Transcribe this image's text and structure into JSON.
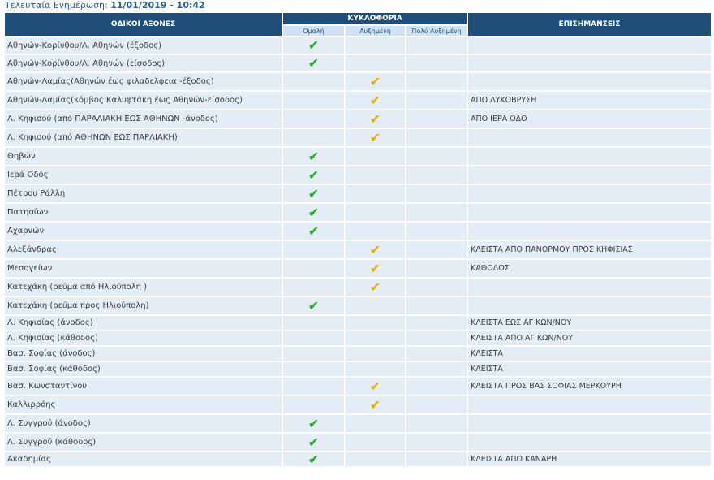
{
  "update": {
    "label": "Τελευταία Ενημέρωση:",
    "value": "11/01/2019 - 10:42"
  },
  "headers": {
    "roads": "ΟΔΙΚΟΙ ΑΞΟΝΕΣ",
    "traffic": "ΚΥΚΛΟΦΟΡΙΑ",
    "notes": "ΕΠΙΣΗΜΑΝΣΕΙΣ",
    "normal": "Ομαλή",
    "increased": "Αυξημένη",
    "very_increased": "Πολύ Αυξημένη"
  },
  "icons": {
    "check": "check-icon",
    "green": "#22b022",
    "yellow": "#e6ac00"
  },
  "rows": [
    {
      "road": "Αθηνών-Κορίνθου/Λ. Αθηνών (έξοδος)",
      "status": "normal",
      "note": ""
    },
    {
      "road": "Αθηνών-Κορίνθου/Λ. Αθηνών (είσοδος)",
      "status": "normal",
      "note": ""
    },
    {
      "road": "Αθηνών-Λαμίας(Αθηνών έως φιλαδελφεια -έξοδος)",
      "status": "increased",
      "note": ""
    },
    {
      "road": "Αθηνών-Λαμίας(κόμβος Καλυφτάκη έως Αθηνών-είσοδος)",
      "status": "increased",
      "note": "ΑΠΟ ΛΥΚΟΒΡΥΣΗ"
    },
    {
      "road": "Λ. Κηφισού (από ΠΑΡΑΛΙΑΚΗ ΕΩΣ ΑΘΗΝΩΝ -άνοδος)",
      "status": "increased",
      "note": "ΑΠΟ ΙΕΡΑ ΟΔΟ"
    },
    {
      "road": "Λ. Κηφισού (από ΑΘΗΝΩΝ ΕΩΣ ΠΑΡΛΙΑΚΗ)",
      "status": "increased",
      "note": ""
    },
    {
      "road": "Θηβών",
      "status": "normal",
      "note": ""
    },
    {
      "road": "Ιερά Οδός",
      "status": "normal",
      "note": ""
    },
    {
      "road": "Πέτρου Ράλλη",
      "status": "normal",
      "note": ""
    },
    {
      "road": "Πατησίων",
      "status": "normal",
      "note": ""
    },
    {
      "road": "Αχαρνών",
      "status": "normal",
      "note": ""
    },
    {
      "road": "Αλεξάνδρας",
      "status": "increased",
      "note": "ΚΛΕΙΣΤΑ ΑΠΟ ΠΑΝΟΡΜΟΥ ΠΡΟΣ ΚΗΦΙΣΙΑΣ"
    },
    {
      "road": "Μεσογείων",
      "status": "increased",
      "note": "ΚΑΘΟΔΟΣ"
    },
    {
      "road": "Κατεχάκη (ρεύμα από Ηλιούπολη )",
      "status": "increased",
      "note": ""
    },
    {
      "road": "Κατεχάκη (ρεύμα προς Ηλιούπολη)",
      "status": "normal",
      "note": ""
    },
    {
      "road": "Λ. Κηφισίας (άνοδος)",
      "status": "",
      "note": "ΚΛΕΙΣΤΑ ΕΩΣ ΑΓ ΚΩΝ/ΝΟΥ"
    },
    {
      "road": "Λ. Κηφισίας (κάθοδος)",
      "status": "",
      "note": "ΚΛΕΙΣΤΑ ΑΠΟ ΑΓ ΚΩΝ/ΝΟΥ"
    },
    {
      "road": "Βασ. Σοφίας (άνοδος)",
      "status": "",
      "note": "ΚΛΕΙΣΤΑ"
    },
    {
      "road": "Βασ. Σοφίας (κάθοδος)",
      "status": "",
      "note": "ΚΛΕΙΣΤΑ"
    },
    {
      "road": "Βασ. Κωνσταντίνου",
      "status": "increased",
      "note": "ΚΛΕΙΣΤΑ ΠΡΟΣ ΒΑΣ ΣΟΦΙΑΣ ΜΕΡΚΟΥΡΗ"
    },
    {
      "road": "Καλλιρρόης",
      "status": "increased",
      "note": ""
    },
    {
      "road": "Λ. Συγγρού (άνοδος)",
      "status": "normal",
      "note": ""
    },
    {
      "road": "Λ. Συγγρού (κάθοδος)",
      "status": "normal",
      "note": ""
    },
    {
      "road": "Ακαδημίας",
      "status": "normal",
      "note": "ΚΛΕΙΣΤΑ ΑΠΟ ΚΑΝΑΡΗ"
    }
  ]
}
